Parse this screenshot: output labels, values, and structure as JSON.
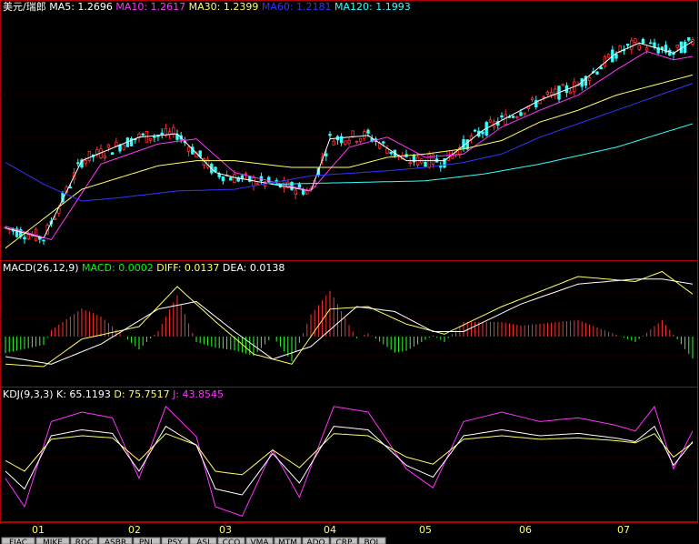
{
  "chart_data": [
    {
      "type": "line",
      "panel": "price",
      "title": "美元/瑞郎",
      "legend_placement": "top-left",
      "grid": true,
      "ylim": [
        1.175,
        1.32
      ],
      "indicators": [
        {
          "name": "MA5",
          "value": "1.2696",
          "color": "#ffffff"
        },
        {
          "name": "MA10",
          "value": "1.2617",
          "color": "#ff33ff"
        },
        {
          "name": "MA30",
          "value": "1.2399",
          "color": "#ffff66"
        },
        {
          "name": "MA60",
          "value": "1.2181",
          "color": "#3333ff"
        },
        {
          "name": "MA120",
          "value": "1.1993",
          "color": "#33ffff"
        }
      ],
      "ma_series_approx": [
        {
          "name": "MA5",
          "color": "#ffffff",
          "points": [
            [
              0,
              1.192
            ],
            [
              10,
              1.186
            ],
            [
              20,
              1.232
            ],
            [
              35,
              1.246
            ],
            [
              45,
              1.248
            ],
            [
              55,
              1.225
            ],
            [
              60,
              1.222
            ],
            [
              80,
              1.214
            ],
            [
              85,
              1.245
            ],
            [
              95,
              1.247
            ],
            [
              105,
              1.232
            ],
            [
              115,
              1.232
            ],
            [
              125,
              1.25
            ],
            [
              140,
              1.268
            ],
            [
              150,
              1.277
            ],
            [
              160,
              1.296
            ],
            [
              166,
              1.302
            ],
            [
              175,
              1.296
            ],
            [
              180,
              1.303
            ]
          ]
        },
        {
          "name": "MA10",
          "color": "#ff33ff",
          "points": [
            [
              0,
              1.193
            ],
            [
              12,
              1.185
            ],
            [
              25,
              1.23
            ],
            [
              40,
              1.242
            ],
            [
              50,
              1.245
            ],
            [
              60,
              1.225
            ],
            [
              80,
              1.214
            ],
            [
              90,
              1.24
            ],
            [
              100,
              1.246
            ],
            [
              110,
              1.234
            ],
            [
              120,
              1.236
            ],
            [
              130,
              1.252
            ],
            [
              140,
              1.262
            ],
            [
              150,
              1.271
            ],
            [
              160,
              1.286
            ],
            [
              168,
              1.297
            ],
            [
              175,
              1.292
            ],
            [
              180,
              1.294
            ]
          ]
        },
        {
          "name": "MA30",
          "color": "#ffff66",
          "points": [
            [
              0,
              1.18
            ],
            [
              20,
              1.215
            ],
            [
              40,
              1.229
            ],
            [
              50,
              1.232
            ],
            [
              60,
              1.232
            ],
            [
              75,
              1.228
            ],
            [
              90,
              1.228
            ],
            [
              100,
              1.234
            ],
            [
              110,
              1.236
            ],
            [
              120,
              1.239
            ],
            [
              130,
              1.244
            ],
            [
              140,
              1.255
            ],
            [
              150,
              1.262
            ],
            [
              160,
              1.271
            ],
            [
              170,
              1.277
            ],
            [
              180,
              1.283
            ]
          ]
        },
        {
          "name": "MA60",
          "color": "#3333ff",
          "points": [
            [
              0,
              1.231
            ],
            [
              10,
              1.218
            ],
            [
              20,
              1.208
            ],
            [
              30,
              1.21
            ],
            [
              45,
              1.214
            ],
            [
              60,
              1.215
            ],
            [
              80,
              1.223
            ],
            [
              100,
              1.226
            ],
            [
              110,
              1.228
            ],
            [
              120,
              1.231
            ],
            [
              130,
              1.236
            ],
            [
              140,
              1.246
            ],
            [
              150,
              1.254
            ],
            [
              160,
              1.262
            ],
            [
              170,
              1.27
            ],
            [
              180,
              1.278
            ]
          ]
        },
        {
          "name": "MA120",
          "color": "#33ffff",
          "points": [
            [
              70,
              1.218
            ],
            [
              90,
              1.219
            ],
            [
              110,
              1.22
            ],
            [
              125,
              1.224
            ],
            [
              140,
              1.23
            ],
            [
              160,
              1.24
            ],
            [
              180,
              1.254
            ]
          ]
        }
      ]
    },
    {
      "type": "bar",
      "panel": "MACD",
      "title": "MACD(26,12,9)",
      "indicators": [
        {
          "name": "MACD",
          "value": "0.0002",
          "color": "#00ff00"
        },
        {
          "name": "DIFF",
          "value": "0.0137",
          "color": "#ffff66"
        },
        {
          "name": "DEA",
          "value": "0.0138",
          "color": "#ffffff"
        }
      ]
    },
    {
      "type": "line",
      "panel": "KDJ",
      "title": "KDJ(9,3,3)",
      "indicators": [
        {
          "name": "K",
          "value": "65.1193",
          "color": "#ffffff"
        },
        {
          "name": "D",
          "value": "75.7517",
          "color": "#ffff66"
        },
        {
          "name": "J",
          "value": "43.8545",
          "color": "#ff33ff"
        }
      ]
    }
  ],
  "x_axis": {
    "ticks": [
      "01",
      "02",
      "03",
      "04",
      "05",
      "06",
      "07"
    ]
  },
  "bottom_tabs": [
    "FIAC",
    "MIKE",
    "ROC",
    "ASBR",
    "PNL",
    "PSY",
    "ASI",
    "CCO",
    "VMA",
    "MTM",
    "ADO",
    "CRP",
    "BOL"
  ]
}
